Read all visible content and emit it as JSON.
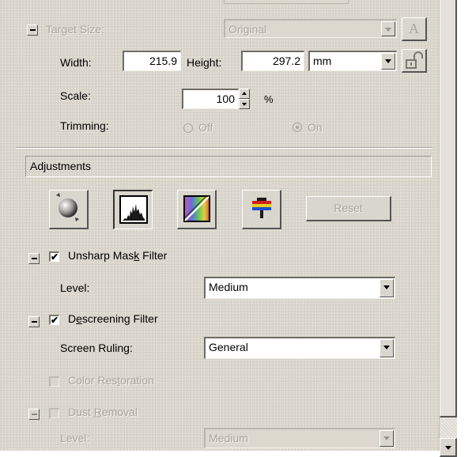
{
  "target_size": {
    "label": "Target Size:",
    "preset_value": "Original",
    "width_label": "Width:",
    "width_value": "215.9",
    "height_label": "Height:",
    "height_value": "297.2",
    "unit_value": "mm",
    "scale_label": "Scale:",
    "scale_value": "100",
    "scale_unit": "%",
    "trimming_label": "Trimming:",
    "trimming_off": "Off",
    "trimming_on": "On"
  },
  "adjustments": {
    "header": "Adjustments",
    "reset_label": "Reset"
  },
  "unsharp": {
    "label_pre": "Unsharp Mas",
    "label_key": "k",
    "label_post": " Filter",
    "checked": true,
    "level_label": "Level:",
    "level_value": "Medium"
  },
  "descreening": {
    "label_pre": "D",
    "label_key": "e",
    "label_post": "screening Filter",
    "checked": true,
    "ruling_label": "Screen Ruling:",
    "ruling_value": "General"
  },
  "color_restoration": {
    "label_pre": "Color Res",
    "label_key": "t",
    "label_post": "oration"
  },
  "dust_removal": {
    "label_pre": "Dust ",
    "label_key": "R",
    "label_post": "emoval",
    "level_label": "Level:",
    "level_value": "Medium"
  },
  "icons": [
    "text-a-icon",
    "lock-icon",
    "auto-tone-icon",
    "histogram-icon",
    "tone-curve-icon",
    "color-balance-icon"
  ]
}
